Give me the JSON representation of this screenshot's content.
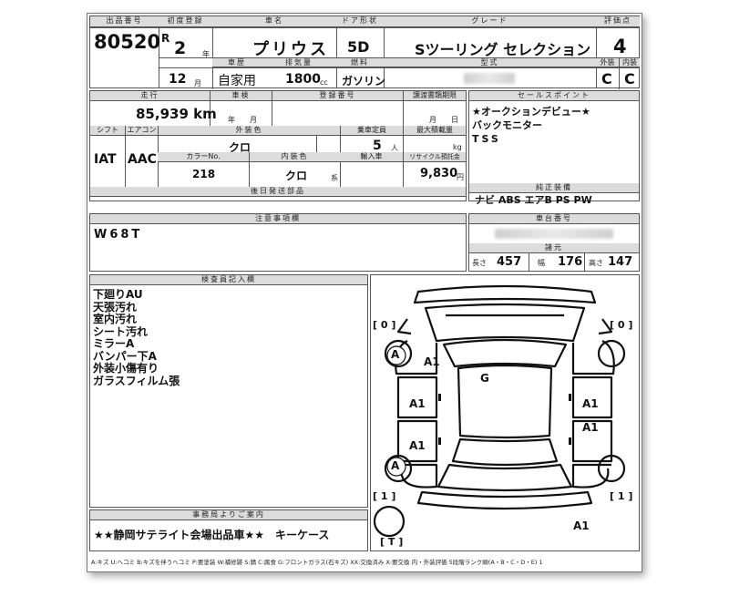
{
  "header": {
    "lot_label": "出品番号",
    "lot_no": "80520",
    "first_reg_label": "初度登録",
    "era": "R",
    "year": "2",
    "year_unit": "年",
    "month": "12",
    "month_unit": "月",
    "name_label": "車名",
    "car_name": "プリウス",
    "door_label": "ドア形状",
    "door": "5D",
    "grade_label": "グレード",
    "grade": "Sツーリング セレクション",
    "score_label": "評価点",
    "score": "4",
    "history_label": "車歴",
    "history": "自家用",
    "disp_label": "排気量",
    "disp": "1800",
    "disp_unit": "cc",
    "fuel_label": "燃料",
    "fuel": "ガソリン",
    "model_label": "型式",
    "ext_label": "外装",
    "ext_grade": "C",
    "int_label": "内装",
    "int_grade": "C"
  },
  "row2": {
    "mileage_label": "走行",
    "mileage": "85,939 km",
    "inspection_label": "車検",
    "inspection_unit": "年　　月",
    "reg_label": "登録番号",
    "transfer_label": "譲渡書類期限",
    "transfer_unit": "月　　日",
    "shift_label": "シフト",
    "shift": "IAT",
    "ac_label": "エアコン",
    "ac": "AAC",
    "color_label": "外装色",
    "color": "クロ",
    "capacity_label": "乗車定員",
    "capacity": "5",
    "capacity_unit": "人",
    "load_label": "最大積載量",
    "load_unit": "kg",
    "color_no_label": "カラーNo.",
    "color_no": "218",
    "int_color_label": "内装色",
    "int_color": "クロ",
    "int_color_unit": "系",
    "import_label": "輸入車",
    "recycle_label": "リサイクル預託金",
    "recycle": "9,830",
    "recycle_unit": "円",
    "docs_label": "後日発送部品"
  },
  "sales": {
    "label": "セールスポイント",
    "lines": [
      "★オークションデビュー★",
      "バックモニター",
      "TSS"
    ],
    "equip_label": "純正装備",
    "equip": "ナビ  ABS  エアB  PS  PW"
  },
  "notes": {
    "label": "注意事項欄",
    "text": "W68T"
  },
  "chassis": {
    "label": "車台番号",
    "dims_label": "諸元",
    "len_label": "長さ",
    "length": "457",
    "wid_label": "幅",
    "width": "176",
    "hei_label": "高さ",
    "height": "147"
  },
  "inspector": {
    "label": "検査員記入欄",
    "lines": [
      "下廻りAU",
      "天張汚れ",
      "室内汚れ",
      "シート汚れ",
      "ミラーA",
      "バンパー下A",
      "外装小傷有り",
      "ガラスフィルム張"
    ]
  },
  "office": {
    "label": "事務局よりご案内",
    "text": "★★静岡サテライト会場出品車★★　キーケース"
  },
  "diagram": {
    "marks": [
      {
        "id": "wheel-fl",
        "text": "A"
      },
      {
        "id": "hood",
        "text": "A1"
      },
      {
        "id": "roof",
        "text": "G"
      },
      {
        "id": "left-front-door",
        "text": "A1"
      },
      {
        "id": "right-front-door",
        "text": "A1"
      },
      {
        "id": "right-rear-door",
        "text": "A1"
      },
      {
        "id": "left-rear-door",
        "text": "A1"
      },
      {
        "id": "wheel-rl",
        "text": "A"
      },
      {
        "id": "rear-bumper",
        "text": "A1"
      }
    ],
    "brackets": [
      {
        "id": "front-left",
        "text": "[ 0 ]"
      },
      {
        "id": "front-right",
        "text": "[ 0 ]"
      },
      {
        "id": "rear-left",
        "text": "[ 1 ]"
      },
      {
        "id": "rear-right",
        "text": "[ 1 ]"
      },
      {
        "id": "tire",
        "text": "[ T ]"
      }
    ]
  },
  "legend": "A:キズ  U:ヘコミ  B:キズを伴うヘコミ  P:要塗装  W:補修跡  S:錆  C:腐食  G:フロントガラス(石キズ)  XX:交換済み  X:要交換  内・外装評価  5段階ランク順(A・B・C・D・E) 1"
}
